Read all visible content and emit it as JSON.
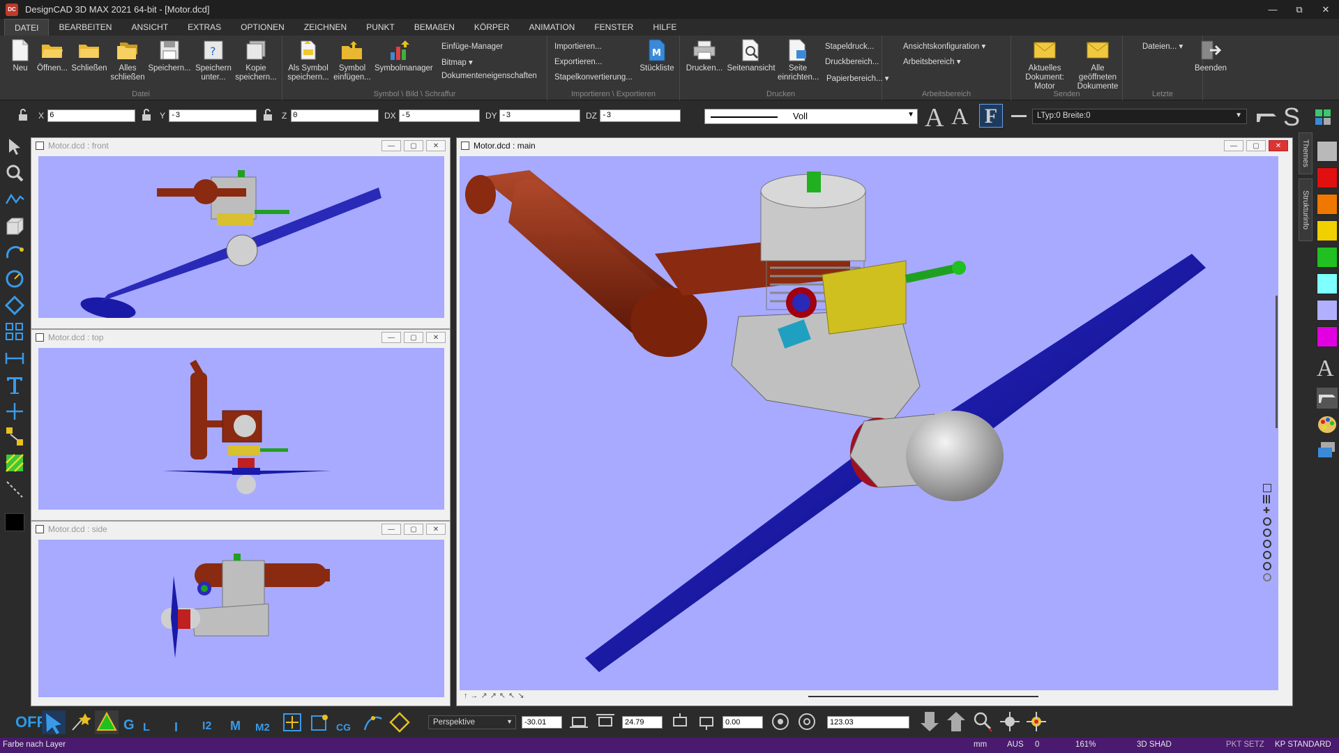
{
  "window": {
    "title": "DesignCAD 3D MAX 2021 64-bit - [Motor.dcd]",
    "app_icon_text": "DC"
  },
  "menu": [
    "DATEI",
    "BEARBEITEN",
    "ANSICHT",
    "EXTRAS",
    "OPTIONEN",
    "ZEICHNEN",
    "PUNKT",
    "BEMAßEN",
    "KÖRPER",
    "ANIMATION",
    "FENSTER",
    "HILFE"
  ],
  "ribbon": {
    "datei": {
      "label": "Datei",
      "buttons": [
        "Neu",
        "Öffnen...",
        "Schließen",
        "Alles schließen",
        "Speichern...",
        "Speichern unter...",
        "Kopie speichern..."
      ]
    },
    "symbol": {
      "label": "Symbol \\ Bild \\ Schraffur",
      "buttons": [
        "Als Symbol speichern...",
        "Symbol einfügen...",
        "Symbolmanager"
      ],
      "small": [
        "Einfüge-Manager",
        "Bitmap",
        "Dokumenteneigenschaften"
      ]
    },
    "import": {
      "label": "Importieren \\ Exportieren",
      "small": [
        "Importieren...",
        "Exportieren...",
        "Stapelkonvertierung..."
      ],
      "buttons": [
        "Stückliste"
      ]
    },
    "drucken": {
      "label": "Drucken",
      "buttons": [
        "Drucken...",
        "Seitenansicht",
        "Seite einrichten..."
      ],
      "small": [
        "Stapeldruck...",
        "Druckbereich...",
        "Papierbereich..."
      ]
    },
    "arbeitsbereich": {
      "label": "Arbeitsbereich",
      "small": [
        "Ansichtskonfiguration",
        "Arbeitsbereich"
      ]
    },
    "senden": {
      "label": "Senden",
      "buttons": [
        "Aktuelles Dokument: Motor",
        "Alle geöffneten Dokumente"
      ]
    },
    "letzte": {
      "label": "Letzte",
      "small": [
        "Dateien..."
      ]
    },
    "beenden": {
      "buttons": [
        "Beenden"
      ]
    }
  },
  "coords": {
    "x": "6",
    "y": "-3",
    "z": "0",
    "dx": "-5",
    "dy": "-3",
    "dz": "-3",
    "labels": [
      "X",
      "Y",
      "Z",
      "DX",
      "DY",
      "DZ"
    ]
  },
  "linestyle": {
    "value": "Voll",
    "ltyp": "LTyp:0  Breite:0",
    "font_letters": [
      "A",
      "A",
      "F"
    ],
    "s_letter": "S"
  },
  "views": {
    "front": {
      "title": "Motor.dcd : front"
    },
    "top": {
      "title": "Motor.dcd : top"
    },
    "side": {
      "title": "Motor.dcd : side"
    },
    "main": {
      "title": "Motor.dcd : main"
    }
  },
  "side_tabs": [
    "Themes",
    "Strukturinfo"
  ],
  "palette": [
    "#b9b9b9",
    "#e01010",
    "#f07800",
    "#f0d000",
    "#20c020",
    "#80ffff",
    "#b0b0ff",
    "#e000e0"
  ],
  "bottom": {
    "off": "OFF",
    "snap_labels": [
      "G",
      "L",
      "I",
      "I2",
      "M",
      "M2",
      "CG"
    ],
    "projection": "Perspektive",
    "val1": "-30.01",
    "val2": "24.79",
    "val3": "0.00",
    "val4": "123.03"
  },
  "status": {
    "left": "Farbe nach Layer",
    "unit": "mm",
    "aus": "AUS",
    "aus_val": "0",
    "zoom": "161%",
    "mode": "3D SHAD",
    "pkt": "PKT SETZ",
    "kp": "KP STANDARD"
  },
  "colors": {
    "viewport_bg": "#a7aaff",
    "status_bg": "#4a1a6e",
    "prop": "#1a1aa8",
    "exhaust": "#8a2a10",
    "engine": "#c8c8c8"
  }
}
